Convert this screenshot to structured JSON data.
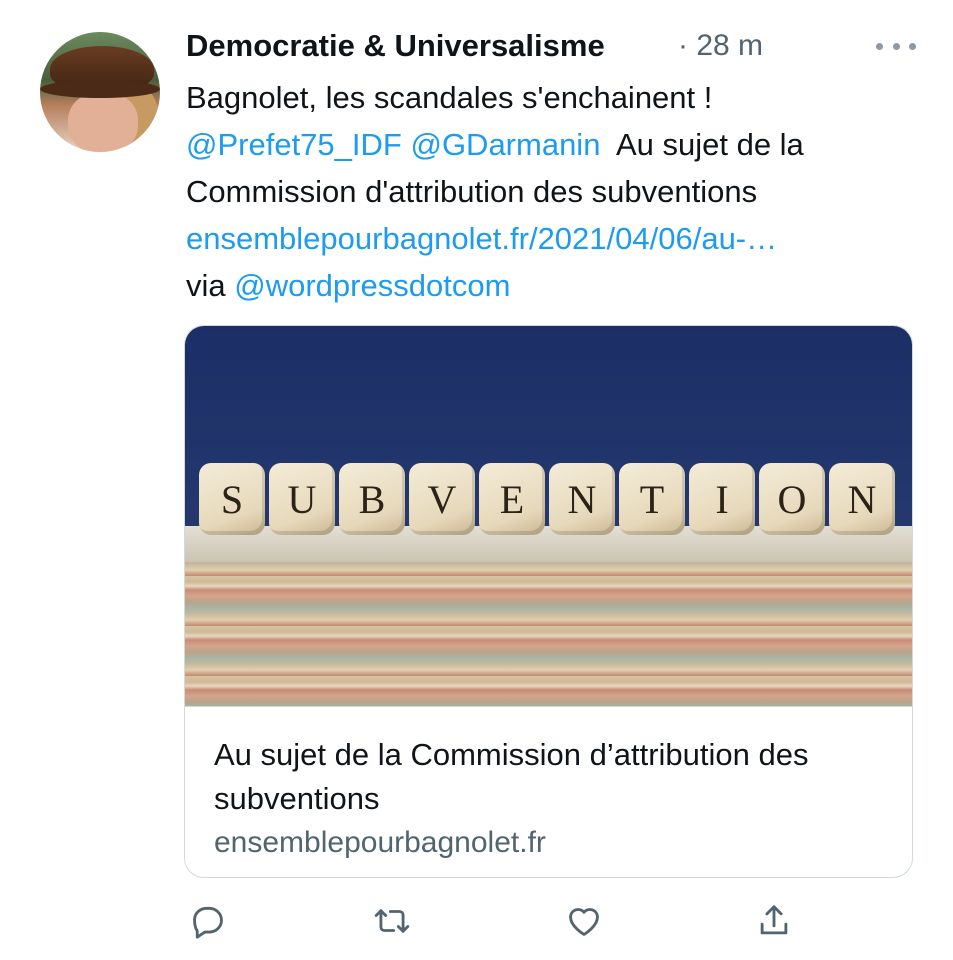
{
  "tweet": {
    "author_name": "Democratie & Universalisme",
    "separator": "·",
    "time": "28 m",
    "text_lines": [
      "Bagnolet, les scandales s'enchainent !",
      "Au sujet de la",
      "Commission d'attribution des subventions",
      "ensemblepourbagnolet.fr/2021/04/06/au-…",
      "via"
    ],
    "mentions": [
      "@Prefet75_IDF",
      "@GDarmanin",
      "@wordpressdotcom"
    ]
  },
  "card": {
    "image_dice_letters": [
      "S",
      "U",
      "B",
      "V",
      "E",
      "N",
      "T",
      "I",
      "O",
      "N"
    ],
    "title": "Au sujet de la Commission d’attribution des subventions",
    "domain": "ensemblepourbagnolet.fr"
  },
  "actions": {
    "reply_icon": "reply-icon",
    "retweet_icon": "retweet-icon",
    "like_icon": "heart-icon",
    "share_icon": "share-icon"
  },
  "colors": {
    "link": "#1d9bf0",
    "secondary_text": "#536471",
    "border": "#cfd9de"
  }
}
